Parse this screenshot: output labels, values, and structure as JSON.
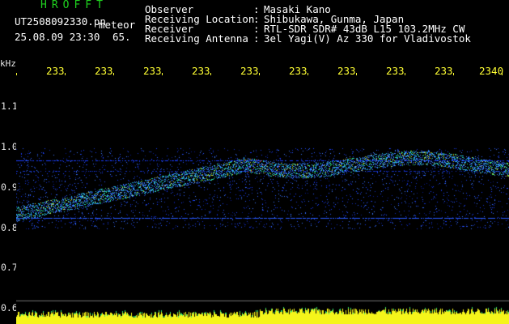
{
  "header": {
    "brand": "HROFFT",
    "file_name": "UT2508092330.pn",
    "file_tag": "meteor",
    "datetime": "25.08.09 23:30",
    "number": "65.",
    "fields": [
      {
        "label": "Observer",
        "value": "Masaki Kano"
      },
      {
        "label": "Receiving Location",
        "value": "Shibukawa, Gunma, Japan"
      },
      {
        "label": "Receiver",
        "value": "RTL-SDR SDR# 43dB L15 103.2MHz CW"
      },
      {
        "label": "Receiving Antenna",
        "value": "3el Yagi(V) Az 330 for Vladivostok"
      }
    ],
    "colon": ":"
  },
  "axis": {
    "y_unit": "kHz",
    "y_labels": [
      "1.1",
      "1.0",
      "0.9",
      "0.8",
      "0.7",
      "0.6"
    ],
    "x_labels": [
      "233",
      "233",
      "233",
      "233",
      "233",
      "233",
      "233",
      "233",
      "233",
      "2340"
    ]
  },
  "colors": {
    "background": "#000000",
    "brand": "#1fd21f",
    "ticks": "#ffff33",
    "signal_low": "#1a3cff",
    "signal_high": "#ff6a1a"
  }
}
